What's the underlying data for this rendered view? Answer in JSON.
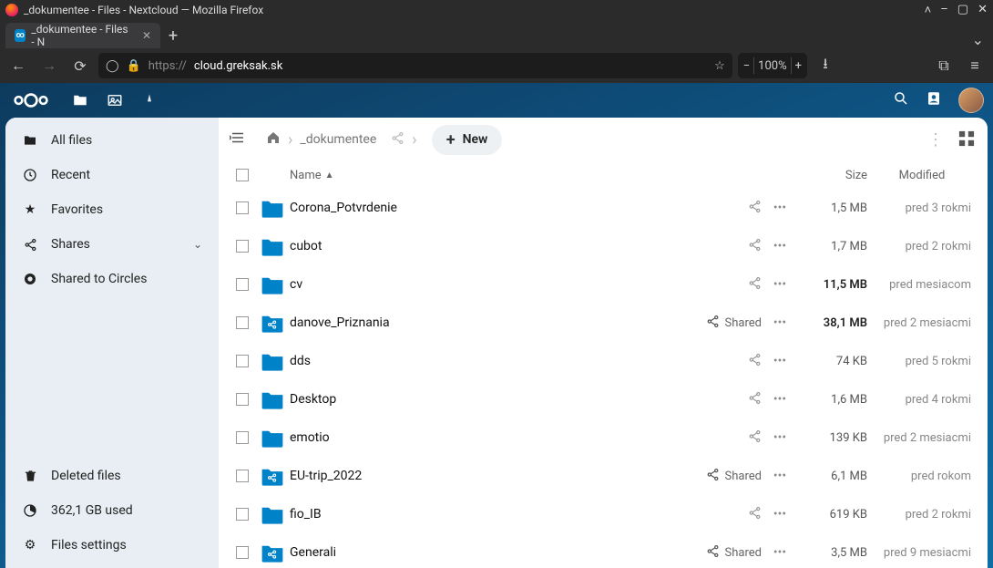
{
  "os": {
    "window_title": "_dokumentee - Files - Nextcloud — Mozilla Firefox"
  },
  "browser": {
    "tab_title": "_dokumentee - Files - N",
    "url_scheme": "https://",
    "url_host": "cloud.greksak.sk",
    "zoom": "100%"
  },
  "nc": {
    "breadcrumb_folder": "_dokumentee",
    "new_label": "New",
    "sidebar": {
      "all_files": "All files",
      "recent": "Recent",
      "favorites": "Favorites",
      "shares": "Shares",
      "shared_circles": "Shared to Circles",
      "deleted": "Deleted files",
      "storage_used": "362,1 GB used",
      "files_settings": "Files settings"
    },
    "columns": {
      "name": "Name",
      "size": "Size",
      "modified": "Modified"
    },
    "shared_label": "Shared",
    "files": [
      {
        "name": "Corona_Potvrdenie",
        "type": "folder",
        "shared": false,
        "size": "1,5 MB",
        "size_bold": false,
        "modified": "pred 3 rokmi"
      },
      {
        "name": "cubot",
        "type": "folder",
        "shared": false,
        "size": "1,7 MB",
        "size_bold": false,
        "modified": "pred 2 rokmi"
      },
      {
        "name": "cv",
        "type": "folder",
        "shared": false,
        "size": "11,5 MB",
        "size_bold": true,
        "modified": "pred mesiacom"
      },
      {
        "name": "danove_Priznania",
        "type": "folder-shared",
        "shared": true,
        "size": "38,1 MB",
        "size_bold": true,
        "modified": "pred 2 mesiacmi"
      },
      {
        "name": "dds",
        "type": "folder",
        "shared": false,
        "size": "74 KB",
        "size_bold": false,
        "modified": "pred 5 rokmi"
      },
      {
        "name": "Desktop",
        "type": "folder",
        "shared": false,
        "size": "1,6 MB",
        "size_bold": false,
        "modified": "pred 4 rokmi"
      },
      {
        "name": "emotio",
        "type": "folder",
        "shared": false,
        "size": "139 KB",
        "size_bold": false,
        "modified": "pred 2 mesiacmi"
      },
      {
        "name": "EU-trip_2022",
        "type": "folder-shared",
        "shared": true,
        "size": "6,1 MB",
        "size_bold": false,
        "modified": "pred rokom"
      },
      {
        "name": "fio_IB",
        "type": "folder",
        "shared": false,
        "size": "619 KB",
        "size_bold": false,
        "modified": "pred 2 rokmi"
      },
      {
        "name": "Generali",
        "type": "folder-shared",
        "shared": true,
        "size": "3,5 MB",
        "size_bold": false,
        "modified": "pred 9 mesiacmi"
      }
    ]
  }
}
